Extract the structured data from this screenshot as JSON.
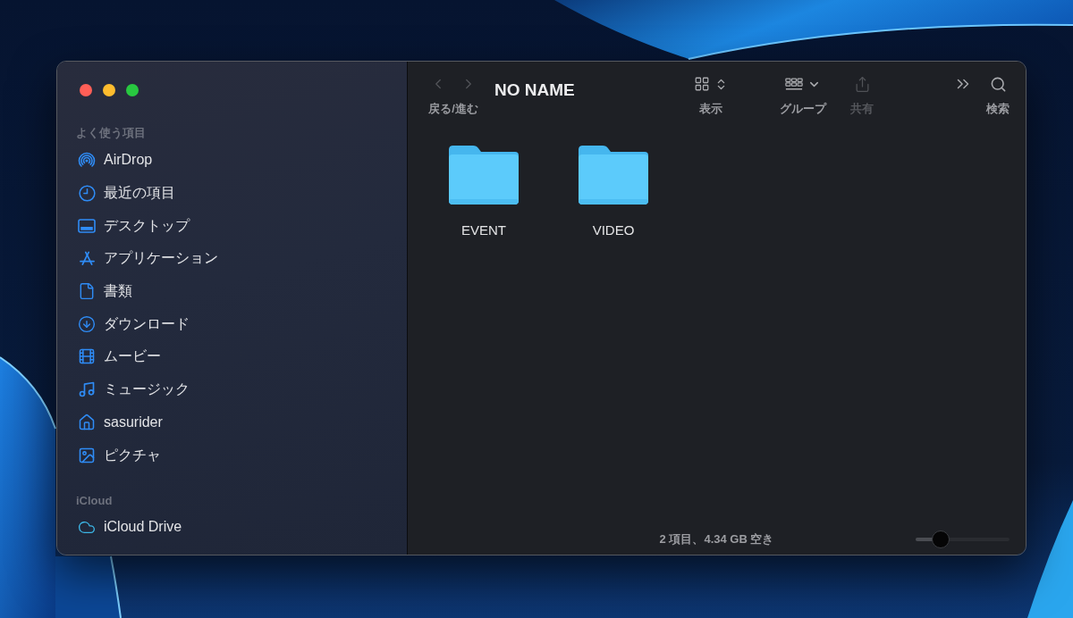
{
  "window": {
    "controls": [
      {
        "kind": "close"
      },
      {
        "kind": "minimize"
      },
      {
        "kind": "zoom"
      }
    ]
  },
  "sidebar": {
    "sections": [
      {
        "title": "よく使う項目",
        "items": [
          {
            "label": "AirDrop",
            "kind": "airdrop",
            "selected": false
          },
          {
            "label": "最近の項目",
            "kind": "recent",
            "selected": false
          },
          {
            "label": "デスクトップ",
            "kind": "desktop",
            "selected": false
          },
          {
            "label": "アプリケーション",
            "kind": "apps",
            "selected": false
          },
          {
            "label": "書類",
            "kind": "documents",
            "selected": false
          },
          {
            "label": "ダウンロード",
            "kind": "downloads",
            "selected": false
          },
          {
            "label": "ムービー",
            "kind": "movies",
            "selected": false
          },
          {
            "label": "ミュージック",
            "kind": "music",
            "selected": false
          },
          {
            "label": "sasurider",
            "kind": "home",
            "selected": false
          },
          {
            "label": "ピクチャ",
            "kind": "pictures",
            "selected": false
          }
        ]
      },
      {
        "title": "iCloud",
        "items": [
          {
            "label": "iCloud Drive",
            "kind": "cloud",
            "selected": false
          }
        ]
      }
    ]
  },
  "toolbar": {
    "back": {
      "disabled": true
    },
    "forward": {
      "disabled": true
    },
    "nav_label": "戻る/進む",
    "title": "NO NAME",
    "buttons": [
      {
        "kind": "view",
        "label": "表示",
        "disabled": false
      },
      {
        "kind": "group",
        "label": "グループ",
        "disabled": false
      },
      {
        "kind": "share",
        "label": "共有",
        "disabled": true
      },
      {
        "kind": "more",
        "disabled": false
      },
      {
        "kind": "search",
        "label": "検索",
        "disabled": false
      }
    ]
  },
  "files": [
    {
      "name": "EVENT",
      "selected": false
    },
    {
      "name": "VIDEO",
      "selected": false
    }
  ],
  "status_bar": {
    "text": "2 項目、4.34 GB 空き",
    "icon_size_slider": {
      "level": 0.27
    }
  }
}
